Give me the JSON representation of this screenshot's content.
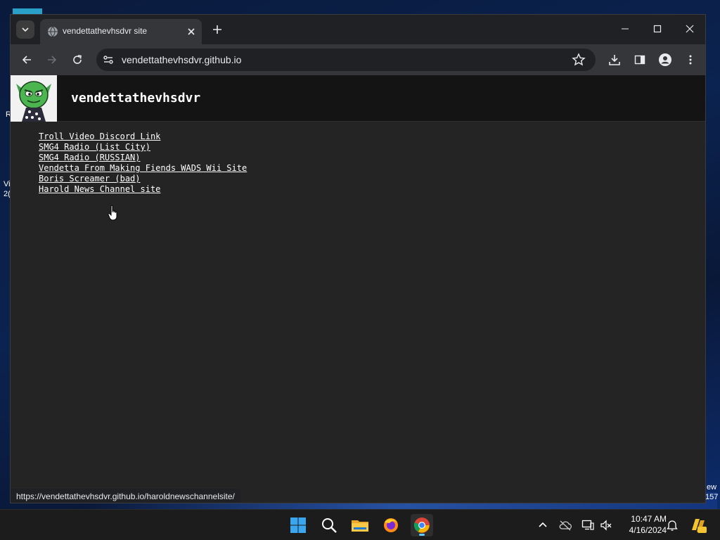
{
  "desktop": {
    "partial_labels": [
      "R",
      "Vi",
      "2(",
      "ew",
      "157"
    ]
  },
  "browser": {
    "tab": {
      "title": "vendettathevhsdvr site",
      "favicon": "globe-icon"
    },
    "address": "vendettathevhsdvr.github.io",
    "status_url": "https://vendettathevhsdvr.github.io/haroldnewschannelsite/"
  },
  "site": {
    "title": "vendettathevhsdvr",
    "links": [
      "Troll Video Discord Link",
      "SMG4 Radio (List City)",
      "SMG4 Radio (RUSSIAN)",
      "Vendetta From Making Fiends WADS Wii Site",
      "Boris Screamer (bad)",
      "Harold News Channel site"
    ]
  },
  "taskbar": {
    "apps": [
      "windows-start-icon",
      "search-icon",
      "file-explorer-icon",
      "firefox-icon",
      "chrome-icon"
    ],
    "time": "10:47 AM",
    "date": "4/16/2024"
  },
  "colors": {
    "page_bg": "#242424",
    "header_bg": "#141414",
    "chrome_dark": "#202124",
    "chrome_toolbar": "#35363a",
    "accent": "#60cdff"
  }
}
